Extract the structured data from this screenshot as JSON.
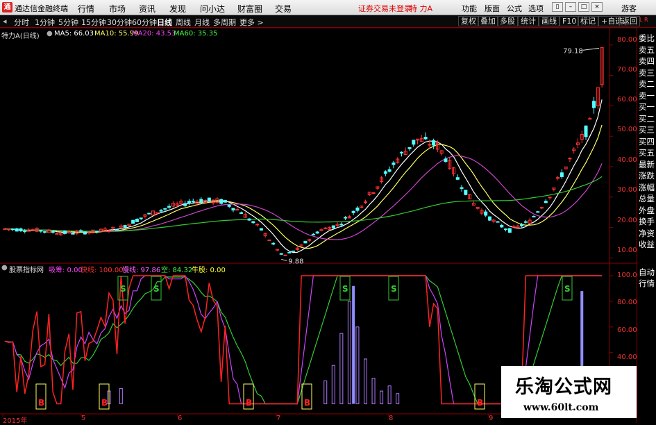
{
  "app": {
    "logo": "通",
    "name": "通达信金融终端",
    "menus": [
      "行情",
      "市场",
      "资讯",
      "发现",
      "问小达",
      "财富圈",
      "交易"
    ],
    "notice": "证券交易未登录",
    "stock_name": "特 力A",
    "right_menus": [
      "功能",
      "版面",
      "公式",
      "选项"
    ],
    "guest": "游客"
  },
  "toolbar": {
    "periods": [
      "分时",
      "1分钟",
      "5分钟",
      "15分钟",
      "30分钟",
      "60分钟",
      "日线",
      "周线",
      "月线",
      "多周期",
      "更多 >"
    ],
    "active_period": "日线",
    "right_buttons": [
      "复权",
      "叠加",
      "多股",
      "统计",
      "画线",
      "F10",
      "标记",
      "+自选",
      "返回"
    ]
  },
  "main_chart": {
    "title": "特力A(日线)",
    "ma": [
      {
        "label": "MA5: 66.03",
        "color": "#ffffff"
      },
      {
        "label": "MA10: 55.99",
        "color": "#ffff66"
      },
      {
        "label": "MA20: 43.53",
        "color": "#ff44ff"
      },
      {
        "label": "MA60: 35.35",
        "color": "#44ff44"
      }
    ],
    "high_label": "79.18",
    "low_label": "9.88",
    "y_ticks": [
      "80.00",
      "70.00",
      "60.00",
      "50.00",
      "40.00",
      "30.00",
      "20.00",
      "10.00"
    ],
    "y_range": [
      8.5,
      82
    ]
  },
  "indicator": {
    "name": "股票指标网",
    "values": [
      {
        "label": "吸筹: 0.00",
        "color": "#ff44ff"
      },
      {
        "label": "快线: 100.00",
        "color": "#ff3333"
      },
      {
        "label": "慢线: 97.86",
        "color": "#ff66ff"
      },
      {
        "label": "空: 84.32",
        "color": "#44ff44"
      },
      {
        "label": "牛股: 0.00",
        "color": "#ffff33"
      }
    ],
    "y_ticks": [
      "100.00",
      "80.00",
      "60.00",
      "40.00"
    ],
    "s_marker": "S",
    "b_marker": "B"
  },
  "x_axis": [
    "2015年",
    "5",
    "6",
    "7",
    "8",
    "9"
  ],
  "sidebar": {
    "top_marks": [
      "L",
      "R"
    ],
    "items": [
      "委比",
      "卖五",
      "卖四",
      "卖三",
      "卖二",
      "卖一",
      "买一",
      "买二",
      "买三",
      "买四",
      "买五",
      "最新",
      "涨跌",
      "涨幅",
      "总量",
      "外盘",
      "换手",
      "净资",
      "收益"
    ],
    "bottom_items": [
      "自动",
      "行情"
    ]
  },
  "watermark": {
    "line1": "乐淘公式网",
    "line2": "www.60lt.com"
  },
  "colors": {
    "up": "#ff3333",
    "down": "#54ffff",
    "axis": "#8b0000",
    "ma5": "#ffffff",
    "ma10": "#ffff66",
    "ma20": "#cc44cc",
    "ma60": "#33cc33"
  }
}
